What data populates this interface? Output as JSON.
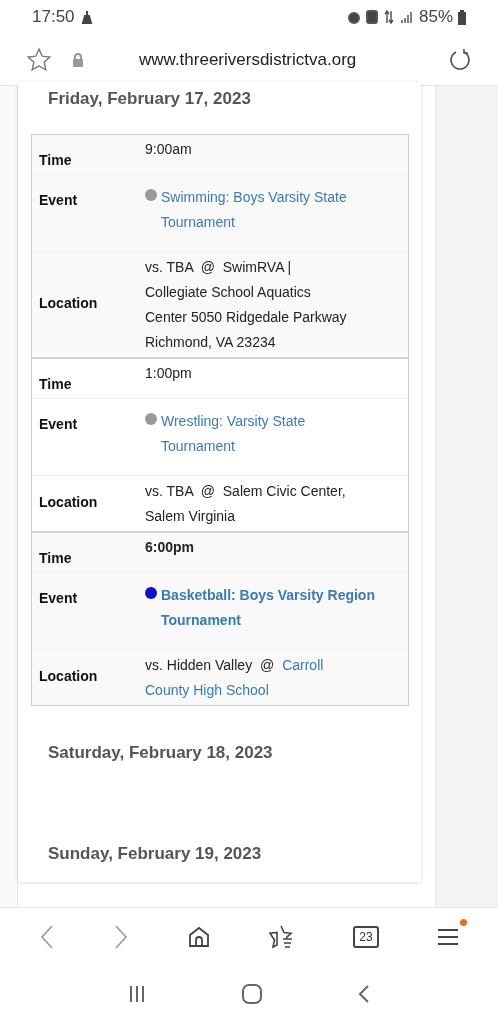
{
  "status_bar": {
    "time": "17:50",
    "battery": "85%"
  },
  "browser": {
    "url": "www.threeriversdistrictva.org"
  },
  "schedule": {
    "days": [
      {
        "date": "Friday, February 17, 2023",
        "events": [
          {
            "time_label": "Time",
            "time": "9:00am",
            "event_label": "Event",
            "event": "Swimming: Boys Varsity State Tournament",
            "color": "#999999",
            "featured": false,
            "location_label": "Location",
            "location_lines": [
              [
                {
                  "text": "vs. TBA  @  SwimRVA |",
                  "link": false
                }
              ],
              [
                {
                  "text": "Collegiate School Aquatics",
                  "link": false
                }
              ],
              [
                {
                  "text": "Center 5050 Ridgedale Parkway",
                  "link": false
                }
              ],
              [
                {
                  "text": "Richmond, VA 23234",
                  "link": false
                }
              ]
            ]
          },
          {
            "time_label": "Time",
            "time": "1:00pm",
            "event_label": "Event",
            "event": "Wrestling: Varsity State Tournament",
            "color": "#999999",
            "featured": false,
            "location_label": "Location",
            "location_lines": [
              [
                {
                  "text": "vs. TBA  @  Salem Civic Center,",
                  "link": false
                }
              ],
              [
                {
                  "text": "Salem Virginia",
                  "link": false
                }
              ]
            ]
          },
          {
            "time_label": "Time",
            "time": "6:00pm",
            "event_label": "Event",
            "event": "Basketball: Boys Varsity Region Tournament",
            "color": "#1010c8",
            "featured": true,
            "location_label": "Location",
            "location_lines": [
              [
                {
                  "text": "vs. Hidden Valley  @",
                  "link": false
                },
                {
                  "text": "Carroll",
                  "link": true
                }
              ],
              [
                {
                  "text": "County High School",
                  "link": true
                }
              ]
            ]
          }
        ]
      },
      {
        "date": "Saturday, February 18, 2023"
      },
      {
        "date": "Sunday, February 19, 2023"
      }
    ]
  },
  "bottom_nav": {
    "tab_count": "23",
    "menu_notification": true
  }
}
